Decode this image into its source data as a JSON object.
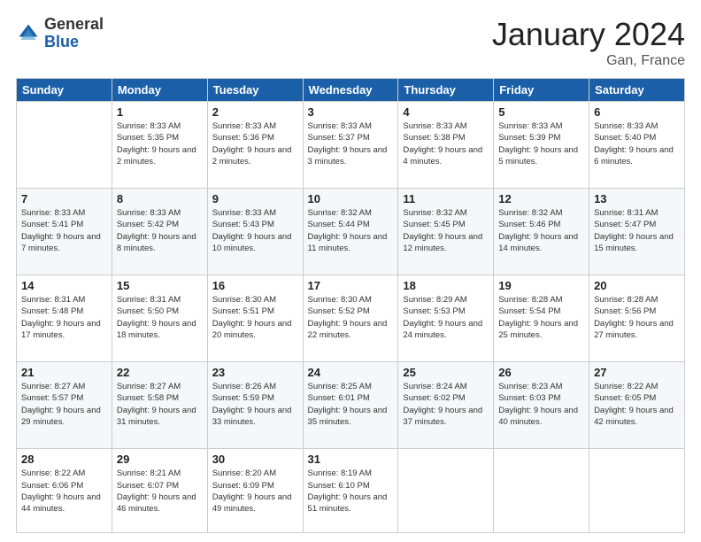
{
  "header": {
    "logo_general": "General",
    "logo_blue": "Blue",
    "month_title": "January 2024",
    "location": "Gan, France"
  },
  "weekdays": [
    "Sunday",
    "Monday",
    "Tuesday",
    "Wednesday",
    "Thursday",
    "Friday",
    "Saturday"
  ],
  "weeks": [
    [
      {
        "day": "",
        "info": ""
      },
      {
        "day": "1",
        "info": "Sunrise: 8:33 AM\nSunset: 5:35 PM\nDaylight: 9 hours\nand 2 minutes."
      },
      {
        "day": "2",
        "info": "Sunrise: 8:33 AM\nSunset: 5:36 PM\nDaylight: 9 hours\nand 2 minutes."
      },
      {
        "day": "3",
        "info": "Sunrise: 8:33 AM\nSunset: 5:37 PM\nDaylight: 9 hours\nand 3 minutes."
      },
      {
        "day": "4",
        "info": "Sunrise: 8:33 AM\nSunset: 5:38 PM\nDaylight: 9 hours\nand 4 minutes."
      },
      {
        "day": "5",
        "info": "Sunrise: 8:33 AM\nSunset: 5:39 PM\nDaylight: 9 hours\nand 5 minutes."
      },
      {
        "day": "6",
        "info": "Sunrise: 8:33 AM\nSunset: 5:40 PM\nDaylight: 9 hours\nand 6 minutes."
      }
    ],
    [
      {
        "day": "7",
        "info": "Sunrise: 8:33 AM\nSunset: 5:41 PM\nDaylight: 9 hours\nand 7 minutes."
      },
      {
        "day": "8",
        "info": "Sunrise: 8:33 AM\nSunset: 5:42 PM\nDaylight: 9 hours\nand 8 minutes."
      },
      {
        "day": "9",
        "info": "Sunrise: 8:33 AM\nSunset: 5:43 PM\nDaylight: 9 hours\nand 10 minutes."
      },
      {
        "day": "10",
        "info": "Sunrise: 8:32 AM\nSunset: 5:44 PM\nDaylight: 9 hours\nand 11 minutes."
      },
      {
        "day": "11",
        "info": "Sunrise: 8:32 AM\nSunset: 5:45 PM\nDaylight: 9 hours\nand 12 minutes."
      },
      {
        "day": "12",
        "info": "Sunrise: 8:32 AM\nSunset: 5:46 PM\nDaylight: 9 hours\nand 14 minutes."
      },
      {
        "day": "13",
        "info": "Sunrise: 8:31 AM\nSunset: 5:47 PM\nDaylight: 9 hours\nand 15 minutes."
      }
    ],
    [
      {
        "day": "14",
        "info": "Sunrise: 8:31 AM\nSunset: 5:48 PM\nDaylight: 9 hours\nand 17 minutes."
      },
      {
        "day": "15",
        "info": "Sunrise: 8:31 AM\nSunset: 5:50 PM\nDaylight: 9 hours\nand 18 minutes."
      },
      {
        "day": "16",
        "info": "Sunrise: 8:30 AM\nSunset: 5:51 PM\nDaylight: 9 hours\nand 20 minutes."
      },
      {
        "day": "17",
        "info": "Sunrise: 8:30 AM\nSunset: 5:52 PM\nDaylight: 9 hours\nand 22 minutes."
      },
      {
        "day": "18",
        "info": "Sunrise: 8:29 AM\nSunset: 5:53 PM\nDaylight: 9 hours\nand 24 minutes."
      },
      {
        "day": "19",
        "info": "Sunrise: 8:28 AM\nSunset: 5:54 PM\nDaylight: 9 hours\nand 25 minutes."
      },
      {
        "day": "20",
        "info": "Sunrise: 8:28 AM\nSunset: 5:56 PM\nDaylight: 9 hours\nand 27 minutes."
      }
    ],
    [
      {
        "day": "21",
        "info": "Sunrise: 8:27 AM\nSunset: 5:57 PM\nDaylight: 9 hours\nand 29 minutes."
      },
      {
        "day": "22",
        "info": "Sunrise: 8:27 AM\nSunset: 5:58 PM\nDaylight: 9 hours\nand 31 minutes."
      },
      {
        "day": "23",
        "info": "Sunrise: 8:26 AM\nSunset: 5:59 PM\nDaylight: 9 hours\nand 33 minutes."
      },
      {
        "day": "24",
        "info": "Sunrise: 8:25 AM\nSunset: 6:01 PM\nDaylight: 9 hours\nand 35 minutes."
      },
      {
        "day": "25",
        "info": "Sunrise: 8:24 AM\nSunset: 6:02 PM\nDaylight: 9 hours\nand 37 minutes."
      },
      {
        "day": "26",
        "info": "Sunrise: 8:23 AM\nSunset: 6:03 PM\nDaylight: 9 hours\nand 40 minutes."
      },
      {
        "day": "27",
        "info": "Sunrise: 8:22 AM\nSunset: 6:05 PM\nDaylight: 9 hours\nand 42 minutes."
      }
    ],
    [
      {
        "day": "28",
        "info": "Sunrise: 8:22 AM\nSunset: 6:06 PM\nDaylight: 9 hours\nand 44 minutes."
      },
      {
        "day": "29",
        "info": "Sunrise: 8:21 AM\nSunset: 6:07 PM\nDaylight: 9 hours\nand 46 minutes."
      },
      {
        "day": "30",
        "info": "Sunrise: 8:20 AM\nSunset: 6:09 PM\nDaylight: 9 hours\nand 49 minutes."
      },
      {
        "day": "31",
        "info": "Sunrise: 8:19 AM\nSunset: 6:10 PM\nDaylight: 9 hours\nand 51 minutes."
      },
      {
        "day": "",
        "info": ""
      },
      {
        "day": "",
        "info": ""
      },
      {
        "day": "",
        "info": ""
      }
    ]
  ]
}
